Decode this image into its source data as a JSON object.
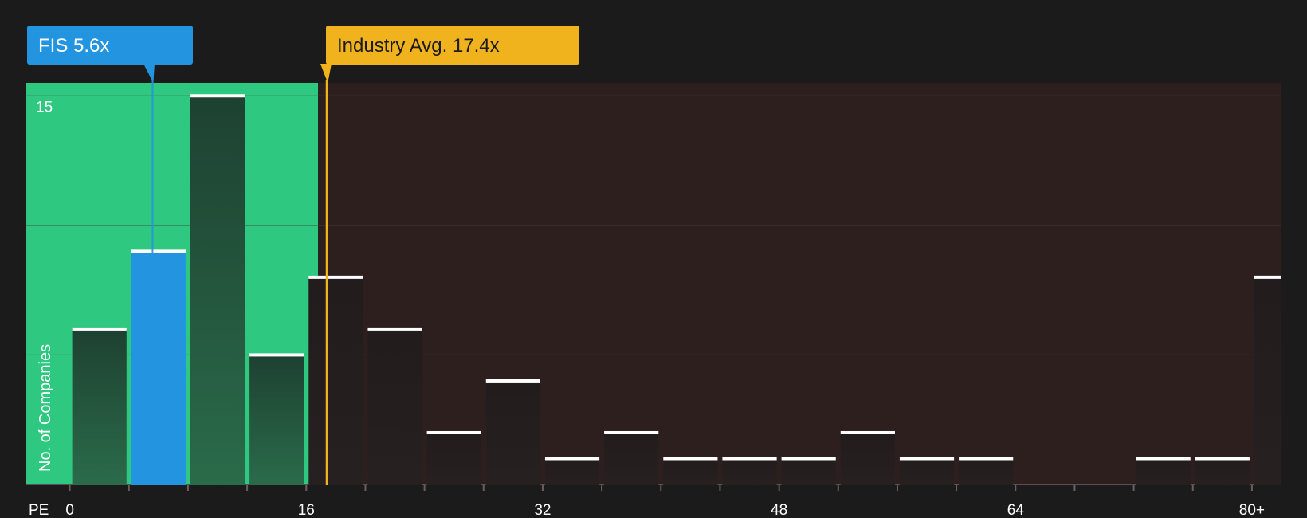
{
  "chart_data": {
    "type": "bar",
    "xlabel": "PE",
    "ylabel": "No. of Companies",
    "x_ticks": [
      "0",
      "16",
      "32",
      "48",
      "64",
      "80+"
    ],
    "x_tick_values": [
      0,
      16,
      32,
      48,
      64,
      80
    ],
    "y_ticks": [
      15
    ],
    "x_range": [
      -3,
      82
    ],
    "y_range": [
      0,
      15.5
    ],
    "bin_width": 4,
    "bins": [
      {
        "start": 0,
        "value": 6
      },
      {
        "start": 4,
        "value": 9,
        "highlight": true
      },
      {
        "start": 8,
        "value": 15
      },
      {
        "start": 12,
        "value": 5
      },
      {
        "start": 16,
        "value": 8
      },
      {
        "start": 20,
        "value": 6
      },
      {
        "start": 24,
        "value": 2
      },
      {
        "start": 28,
        "value": 4
      },
      {
        "start": 32,
        "value": 1
      },
      {
        "start": 36,
        "value": 2
      },
      {
        "start": 40,
        "value": 1
      },
      {
        "start": 44,
        "value": 1
      },
      {
        "start": 48,
        "value": 1
      },
      {
        "start": 52,
        "value": 2
      },
      {
        "start": 56,
        "value": 1
      },
      {
        "start": 60,
        "value": 1
      },
      {
        "start": 64,
        "value": 0
      },
      {
        "start": 68,
        "value": 0
      },
      {
        "start": 72,
        "value": 1
      },
      {
        "start": 76,
        "value": 1
      },
      {
        "start": 80,
        "value": 8
      }
    ],
    "markers": [
      {
        "label": "FIS 5.6x",
        "value": 5.6,
        "color": "#2394e0"
      },
      {
        "label": "Industry Avg. 17.4x",
        "value": 17.4,
        "color": "#f0b21d"
      }
    ],
    "fair_zone_end": 16.8,
    "colors": {
      "background": "#1b1b1b",
      "fair_zone": "#2ec880",
      "above_zone": "#2e1f1f",
      "bar_in_zone": "#1f4a33",
      "bar_out_zone": "#241e1e",
      "bar_highlight": "#2394e0",
      "bar_cap": "#ffffff",
      "grid": "#4a4040"
    }
  }
}
